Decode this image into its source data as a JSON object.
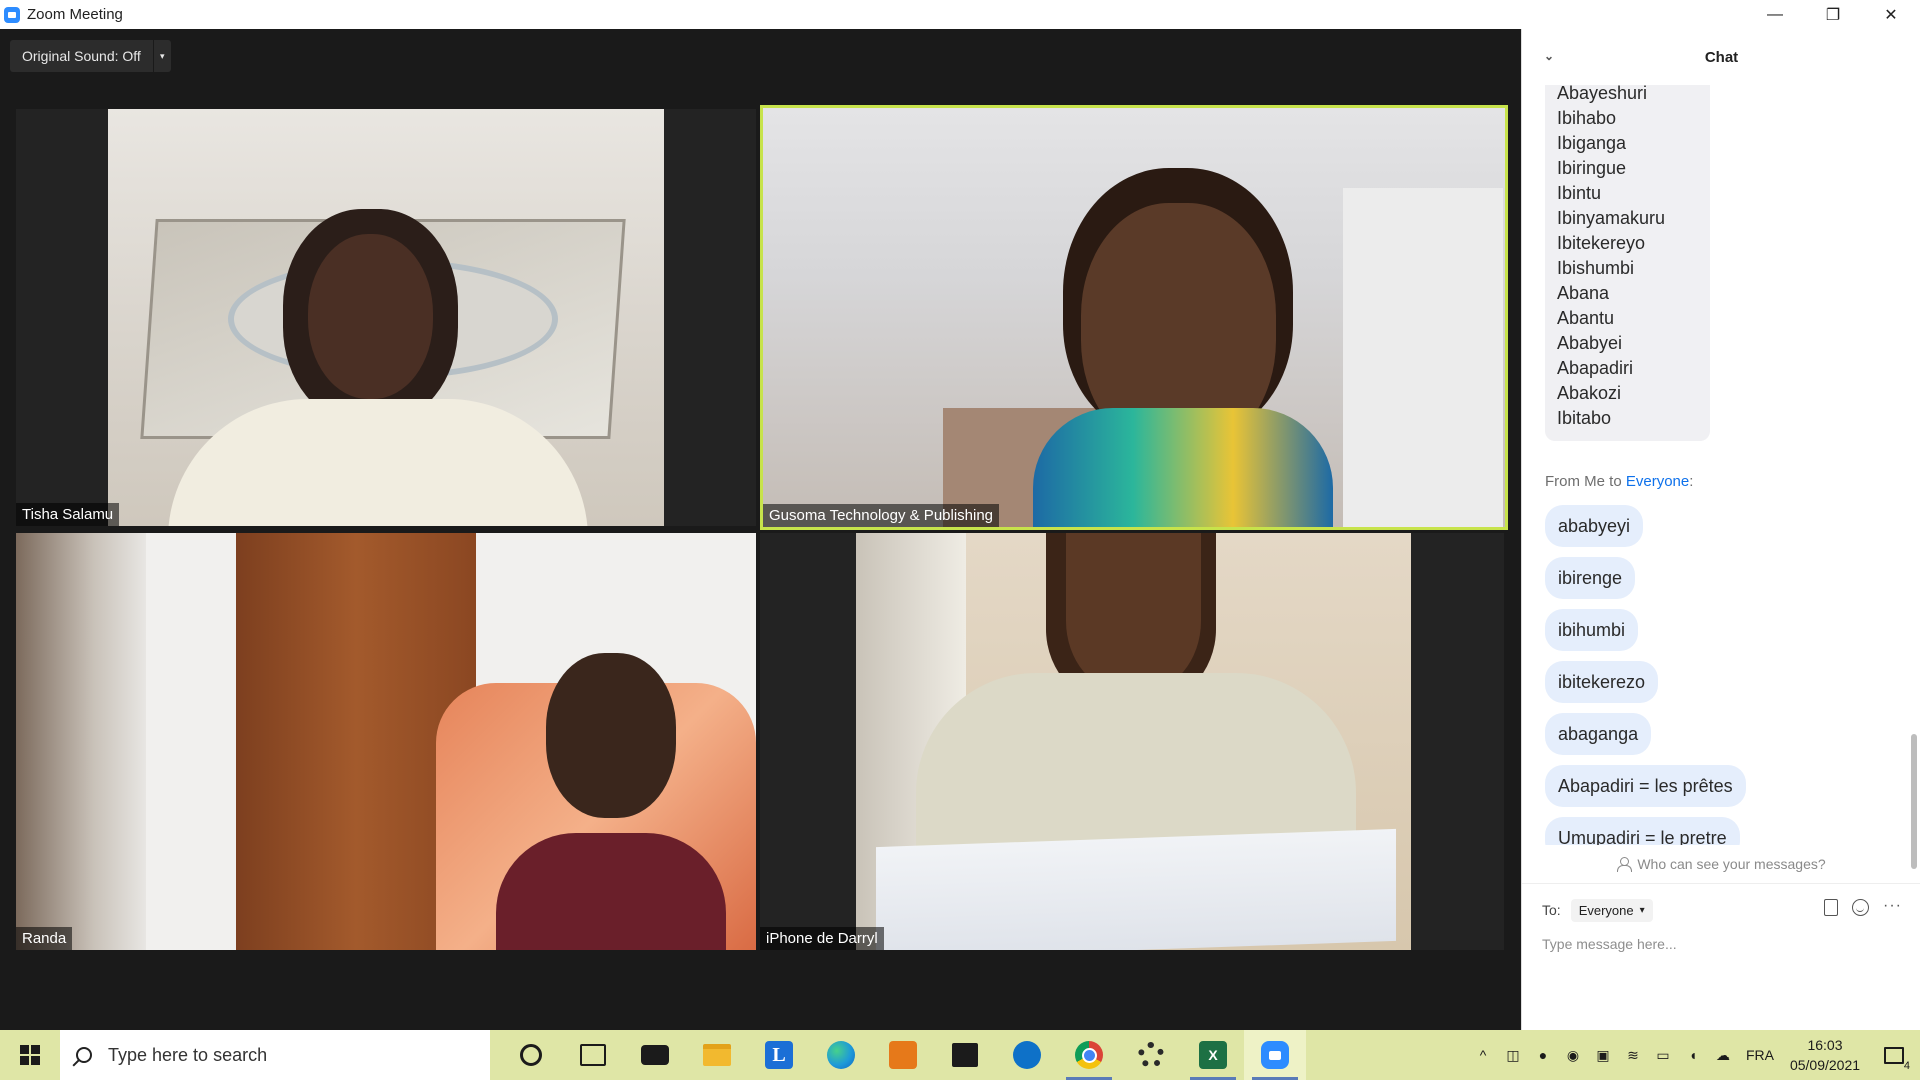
{
  "window": {
    "title": "Zoom Meeting",
    "controls": {
      "minimize": "—",
      "restore": "❐",
      "close": "✕"
    }
  },
  "toolbar": {
    "original_sound_label": "Original Sound: Off",
    "caret": "▾"
  },
  "participants": [
    {
      "name": "Tisha Salamu",
      "active_speaker": false
    },
    {
      "name": "Gusoma Technology & Publishing",
      "active_speaker": true
    },
    {
      "name": "Randa",
      "active_speaker": false
    },
    {
      "name": "iPhone de Darryl",
      "active_speaker": false
    }
  ],
  "chat": {
    "header": "Chat",
    "collapse_icon": "⌄",
    "previous_list": [
      "Abayeshuri",
      "Ibihabo",
      "Ibiganga",
      "Ibiringue",
      "Ibintu",
      "Ibinyamakuru",
      "Ibitekereyo",
      "Ibishumbi",
      "Abana",
      "Abantu",
      "Ababyei",
      "Abapadiri",
      "Abakozi",
      "Ibitabo"
    ],
    "from_prefix": "From Me to ",
    "from_target": "Everyone",
    "from_suffix": ":",
    "messages": [
      "ababyeyi",
      "ibirenge",
      "ibihumbi",
      "ibitekerezo",
      "abaganga",
      "Abapadiri = les prêtes",
      "Umupadiri = le pretre"
    ],
    "privacy_note": "Who can see your messages?",
    "to_label": "To:",
    "to_value": "Everyone",
    "more": "···",
    "input_placeholder": "Type message here..."
  },
  "taskbar": {
    "search_placeholder": "Type here to search",
    "pinned_apps": [
      {
        "name": "cortana-icon"
      },
      {
        "name": "task-view-icon"
      },
      {
        "name": "mail-icon"
      },
      {
        "name": "file-explorer-icon"
      },
      {
        "name": "l-app-icon",
        "glyph": "L"
      },
      {
        "name": "edge-icon"
      },
      {
        "name": "orange-app-icon"
      },
      {
        "name": "store-icon"
      },
      {
        "name": "outlook-icon"
      },
      {
        "name": "chrome-icon"
      },
      {
        "name": "settings-icon"
      },
      {
        "name": "excel-icon",
        "glyph": "X"
      },
      {
        "name": "zoom-icon"
      }
    ],
    "tray": {
      "chevron": "^",
      "language": "FRA",
      "time": "16:03",
      "date": "05/09/2021",
      "notification_count": "4"
    }
  },
  "colors": {
    "active_speaker_border": "#c7e34b",
    "taskbar_bg": "#dfe6a6",
    "chat_bubble_bg": "#e5eefc",
    "link_blue": "#0e71eb"
  }
}
